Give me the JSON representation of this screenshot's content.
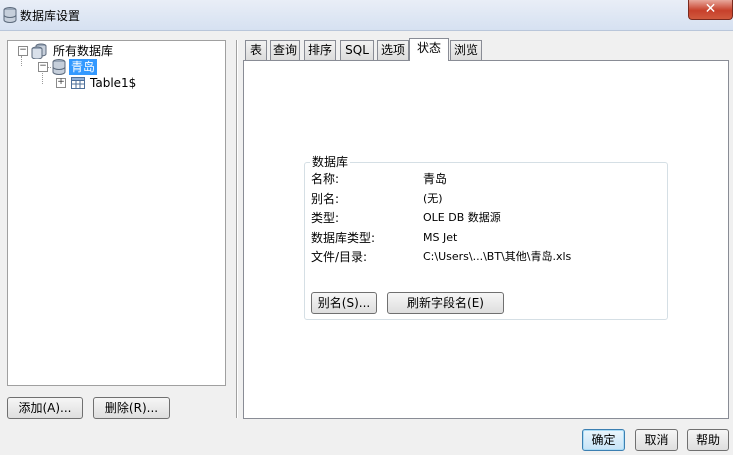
{
  "window": {
    "title": "数据库设置",
    "close_glyph": "✕"
  },
  "tree": {
    "root": {
      "label": "所有数据库",
      "expander": "−"
    },
    "database": {
      "label": "青岛",
      "expander": "−"
    },
    "table": {
      "label": "Table1$",
      "expander": "+"
    }
  },
  "left_buttons": {
    "add": "添加(A)...",
    "delete": "删除(R)..."
  },
  "tabs": [
    {
      "label": "表"
    },
    {
      "label": "查询"
    },
    {
      "label": "排序"
    },
    {
      "label": "SQL"
    },
    {
      "label": "选项"
    },
    {
      "label": "状态"
    },
    {
      "label": "浏览"
    }
  ],
  "active_tab": "状态",
  "status": {
    "group_title": "数据库",
    "rows": [
      {
        "key": "名称:",
        "value": "青岛"
      },
      {
        "key": "别名:",
        "value": "(无)"
      },
      {
        "key": "类型:",
        "value": "OLE DB 数据源"
      },
      {
        "key": "数据库类型:",
        "value": "MS Jet"
      },
      {
        "key": "文件/目录:",
        "value": "C:\\Users\\...\\BT\\其他\\青岛.xls"
      }
    ],
    "alias_button": "别名(S)...",
    "refresh_button": "刷新字段名(E)"
  },
  "dialog_buttons": {
    "ok": "确定",
    "cancel": "取消",
    "help": "帮助"
  },
  "icons": {
    "title": "database-icon",
    "root": "database-group-icon",
    "database": "database-icon",
    "table": "table-icon"
  },
  "colors": {
    "selection": "#3399ff",
    "close_button": "#c7402b"
  }
}
